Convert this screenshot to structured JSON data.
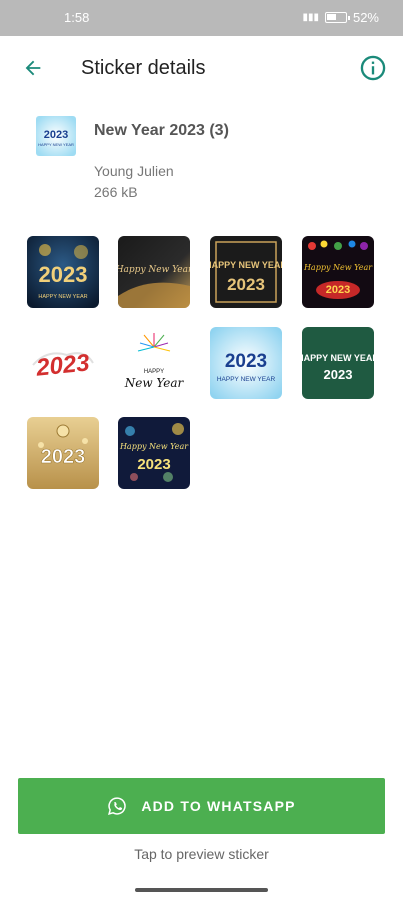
{
  "status": {
    "time": "1:58",
    "battery": "52%",
    "battery_level": 0.52
  },
  "toolbar": {
    "back_icon": "arrow-left-icon",
    "title": "Sticker details",
    "info_icon": "info-icon"
  },
  "pack": {
    "name": "New Year 2023 (3)",
    "author": "Young Julien",
    "size": "266 kB",
    "thumb_text_top": "2023",
    "thumb_text_bottom": "HAPPY NEW YEAR"
  },
  "stickers": [
    {
      "text_main": "2023",
      "text_sub": "HAPPY NEW YEAR"
    },
    {
      "text_main": "Happy New Year"
    },
    {
      "text_main": "HAPPY NEW YEAR",
      "text_sub": "2023"
    },
    {
      "text_main": "Happy New Year",
      "text_sub": "2023"
    },
    {
      "text_main": "2023"
    },
    {
      "text_main": "HAPPY",
      "text_sub": "New Year"
    },
    {
      "text_main": "2023",
      "text_sub": "HAPPY NEW YEAR"
    },
    {
      "text_main": "HAPPY NEW YEAR",
      "text_sub": "2023"
    },
    {
      "text_main": "2023"
    },
    {
      "text_main": "Happy New Year",
      "text_sub": "2023"
    }
  ],
  "actions": {
    "add_label": "ADD TO WHATSAPP",
    "add_icon": "whatsapp-icon",
    "hint": "Tap to preview sticker"
  },
  "colors": {
    "accent": "#1b8a7a",
    "button": "#4caf50",
    "status_bar": "#b9b9b9"
  }
}
